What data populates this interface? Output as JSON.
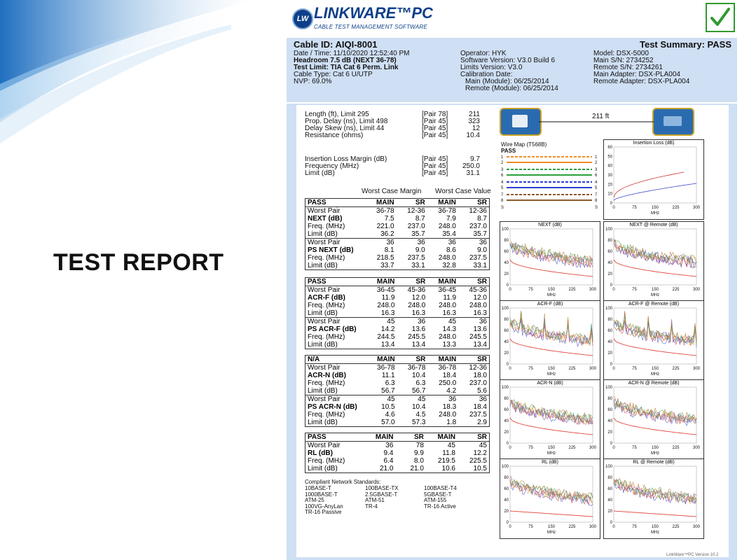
{
  "slide": {
    "title": "TEST REPORT"
  },
  "brand": {
    "badge": "LW",
    "name": "LINKWARE™PC",
    "subtitle": "CABLE TEST MANAGEMENT SOFTWARE",
    "check_icon": "checkmark-icon",
    "accent": "#0d3f88",
    "panel_bg": "#cfdff4",
    "pass_green": "#2f9a2f"
  },
  "summary": {
    "cable_id": "Cable ID: AIQI-8001",
    "test_summary": "Test Summary: PASS",
    "left": [
      "Date / Time: 11/10/2020  12:52:40 PM",
      "Headroom 7.5 dB (NEXT 36-78)",
      "Test Limit: TIA Cat 6 Perm. Link",
      "Cable Type: Cat 6 U/UTP",
      "NVP: 69.0%"
    ],
    "middle": [
      "Operator: HYK",
      "Software Version: V3.0 Build 6",
      "Limits Version: V3.0",
      "Calibration Date:",
      "  Main (Module): 06/25/2014",
      "  Remote (Module): 06/25/2014"
    ],
    "right": [
      "Model: DSX-5000",
      "Main S/N: 2734252",
      "Remote S/N: 2734261",
      "Main Adapter: DSX-PLA004",
      "Remote Adapter: DSX-PLA004"
    ]
  },
  "measurements": [
    {
      "label": "Length (ft), Limit 295",
      "pair": "[Pair 78]",
      "value": "211"
    },
    {
      "label": "Prop. Delay (ns), Limit 498",
      "pair": "[Pair 45]",
      "value": "323"
    },
    {
      "label": "Delay Skew (ns), Limit 44",
      "pair": "[Pair 45]",
      "value": "12"
    },
    {
      "label": "Resistance (ohms)",
      "pair": "[Pair 45]",
      "value": "10.4"
    },
    {
      "label": "Insertion Loss Margin (dB)",
      "pair": "[Pair 45]",
      "value": "9.7"
    },
    {
      "label": "Frequency (MHz)",
      "pair": "[Pair 45]",
      "value": "250.0"
    },
    {
      "label": "Limit (dB)",
      "pair": "[Pair 45]",
      "value": "31.1"
    }
  ],
  "col_heads": {
    "margin": "Worst Case Margin",
    "value": "Worst Case Value"
  },
  "tables": [
    {
      "status": "PASS",
      "cols": [
        "MAIN",
        "SR",
        "MAIN",
        "SR"
      ],
      "rows": [
        [
          "Worst Pair",
          "36-78",
          "12-36",
          "36-78",
          "12-36"
        ],
        [
          "NEXT (dB)",
          "7.5",
          "8.7",
          "7.9",
          "8.7"
        ],
        [
          "Freq. (MHz)",
          "221.0",
          "237.0",
          "248.0",
          "237.0"
        ],
        [
          "Limit (dB)",
          "36.2",
          "35.7",
          "35.4",
          "35.7"
        ],
        [
          "Worst Pair",
          "36",
          "36",
          "36",
          "36"
        ],
        [
          "PS NEXT (dB)",
          "8.1",
          "9.0",
          "8.6",
          "9.0"
        ],
        [
          "Freq. (MHz)",
          "218.5",
          "237.5",
          "248.0",
          "237.5"
        ],
        [
          "Limit (dB)",
          "33.7",
          "33.1",
          "32.8",
          "33.1"
        ]
      ]
    },
    {
      "status": "PASS",
      "cols": [
        "MAIN",
        "SR",
        "MAIN",
        "SR"
      ],
      "rows": [
        [
          "Worst Pair",
          "36-45",
          "45-36",
          "36-45",
          "45-36"
        ],
        [
          "ACR-F (dB)",
          "11.9",
          "12.0",
          "11.9",
          "12.0"
        ],
        [
          "Freq. (MHz)",
          "248.0",
          "248.0",
          "248.0",
          "248.0"
        ],
        [
          "Limit (dB)",
          "16.3",
          "16.3",
          "16.3",
          "16.3"
        ],
        [
          "Worst Pair",
          "45",
          "36",
          "45",
          "36"
        ],
        [
          "PS ACR-F (dB)",
          "14.2",
          "13.6",
          "14.3",
          "13.6"
        ],
        [
          "Freq. (MHz)",
          "244.5",
          "245.5",
          "248.0",
          "245.5"
        ],
        [
          "Limit (dB)",
          "13.4",
          "13.4",
          "13.3",
          "13.4"
        ]
      ]
    },
    {
      "status": "N/A",
      "cols": [
        "MAIN",
        "SR",
        "MAIN",
        "SR"
      ],
      "rows": [
        [
          "Worst Pair",
          "36-78",
          "36-78",
          "36-78",
          "12-36"
        ],
        [
          "ACR-N (dB)",
          "11.1",
          "10.4",
          "18.4",
          "18.0"
        ],
        [
          "Freq. (MHz)",
          "6.3",
          "6.3",
          "250.0",
          "237.0"
        ],
        [
          "Limit (dB)",
          "56.7",
          "56.7",
          "4.2",
          "5.6"
        ],
        [
          "Worst Pair",
          "45",
          "45",
          "36",
          "36"
        ],
        [
          "PS ACR-N (dB)",
          "10.5",
          "10.4",
          "18.3",
          "18.4"
        ],
        [
          "Freq. (MHz)",
          "4.6",
          "4.5",
          "248.0",
          "237.5"
        ],
        [
          "Limit (dB)",
          "57.0",
          "57.3",
          "1.8",
          "2.9"
        ]
      ]
    },
    {
      "status": "PASS",
      "cols": [
        "MAIN",
        "SR",
        "MAIN",
        "SR"
      ],
      "rows": [
        [
          "Worst Pair",
          "36",
          "78",
          "45",
          "45"
        ],
        [
          "RL (dB)",
          "9.4",
          "9.9",
          "11.8",
          "12.2"
        ],
        [
          "Freq. (MHz)",
          "6.4",
          "8.0",
          "219.5",
          "225.5"
        ],
        [
          "Limit (dB)",
          "21.0",
          "21.0",
          "10.6",
          "10.5"
        ]
      ]
    }
  ],
  "standards": {
    "title": "Compliant Network Standards:",
    "items": [
      "10BASE-T",
      "100BASE-TX",
      "100BASE-T4",
      "1000BASE-T",
      "2.5GBASE-T",
      "5GBASE-T",
      "ATM-25",
      "ATM-51",
      "ATM-155",
      "100VG-AnyLan",
      "TR-4",
      "TR-16 Active",
      "TR-16 Passive"
    ]
  },
  "length_display": "211 ft",
  "wiremap": {
    "title": "Wire Map (T568B)",
    "status": "PASS",
    "pins": [
      [
        "1",
        "1"
      ],
      [
        "2",
        "2"
      ],
      [
        "3",
        "3"
      ],
      [
        "6",
        "6"
      ],
      [
        "4",
        "4"
      ],
      [
        "5",
        "5"
      ],
      [
        "7",
        "7"
      ],
      [
        "8",
        "8"
      ],
      [
        "S",
        "S"
      ]
    ],
    "colors": [
      "#f28c28",
      "#f28c28",
      "#2e9e3e",
      "#2e9e3e",
      "#2c3fcf",
      "#2c3fcf",
      "#8a5a2b",
      "#8a5a2b"
    ]
  },
  "chart_data": [
    {
      "type": "line",
      "title": "Insertion Loss (dB)",
      "xlabel": "MHz",
      "xlim": [
        0,
        300
      ],
      "ylim": [
        0,
        60
      ],
      "xticks": [
        "0",
        "75",
        "150",
        "225",
        "300"
      ],
      "yticks": [
        "0",
        "10",
        "20",
        "30",
        "40",
        "50",
        "60"
      ]
    },
    {
      "type": "line",
      "title": "NEXT (dB)",
      "xlabel": "MHz",
      "xlim": [
        0,
        300
      ],
      "ylim": [
        0,
        100
      ],
      "xticks": [
        "0",
        "75",
        "150",
        "225",
        "300"
      ],
      "yticks": [
        "0",
        "20",
        "40",
        "60",
        "80",
        "100"
      ]
    },
    {
      "type": "line",
      "title": "NEXT @ Remote (dB)",
      "xlabel": "MHz",
      "xlim": [
        0,
        300
      ],
      "ylim": [
        0,
        100
      ],
      "xticks": [
        "0",
        "75",
        "150",
        "225",
        "300"
      ],
      "yticks": [
        "0",
        "20",
        "40",
        "60",
        "80",
        "100"
      ]
    },
    {
      "type": "line",
      "title": "ACR-F (dB)",
      "xlabel": "MHz",
      "xlim": [
        0,
        300
      ],
      "ylim": [
        0,
        100
      ],
      "xticks": [
        "0",
        "75",
        "150",
        "225",
        "300"
      ],
      "yticks": [
        "0",
        "20",
        "40",
        "60",
        "80",
        "100"
      ]
    },
    {
      "type": "line",
      "title": "ACR-F @ Remote (dB)",
      "xlabel": "MHz",
      "xlim": [
        0,
        300
      ],
      "ylim": [
        0,
        100
      ],
      "xticks": [
        "0",
        "75",
        "150",
        "225",
        "300"
      ],
      "yticks": [
        "0",
        "20",
        "40",
        "60",
        "80",
        "100"
      ]
    },
    {
      "type": "line",
      "title": "ACR-N (dB)",
      "xlabel": "MHz",
      "xlim": [
        0,
        300
      ],
      "ylim": [
        0,
        100
      ],
      "xticks": [
        "0",
        "75",
        "150",
        "225",
        "300"
      ],
      "yticks": [
        "0",
        "20",
        "40",
        "60",
        "80",
        "100"
      ]
    },
    {
      "type": "line",
      "title": "ACR-N @ Remote (dB)",
      "xlabel": "MHz",
      "xlim": [
        0,
        300
      ],
      "ylim": [
        0,
        100
      ],
      "xticks": [
        "0",
        "75",
        "150",
        "225",
        "300"
      ],
      "yticks": [
        "0",
        "20",
        "40",
        "60",
        "80",
        "100"
      ]
    },
    {
      "type": "line",
      "title": "RL (dB)",
      "xlabel": "MHz",
      "xlim": [
        0,
        300
      ],
      "ylim": [
        0,
        100
      ],
      "xticks": [
        "0",
        "75",
        "150",
        "225",
        "300"
      ],
      "yticks": [
        "0",
        "20",
        "40",
        "60",
        "80",
        "100"
      ]
    },
    {
      "type": "line",
      "title": "RL @ Remote (dB)",
      "xlabel": "MHz",
      "xlim": [
        0,
        300
      ],
      "ylim": [
        0,
        100
      ],
      "xticks": [
        "0",
        "75",
        "150",
        "225",
        "300"
      ],
      "yticks": [
        "0",
        "20",
        "40",
        "60",
        "80",
        "100"
      ]
    }
  ],
  "footer": "LinkWare™PC Version 10.2"
}
